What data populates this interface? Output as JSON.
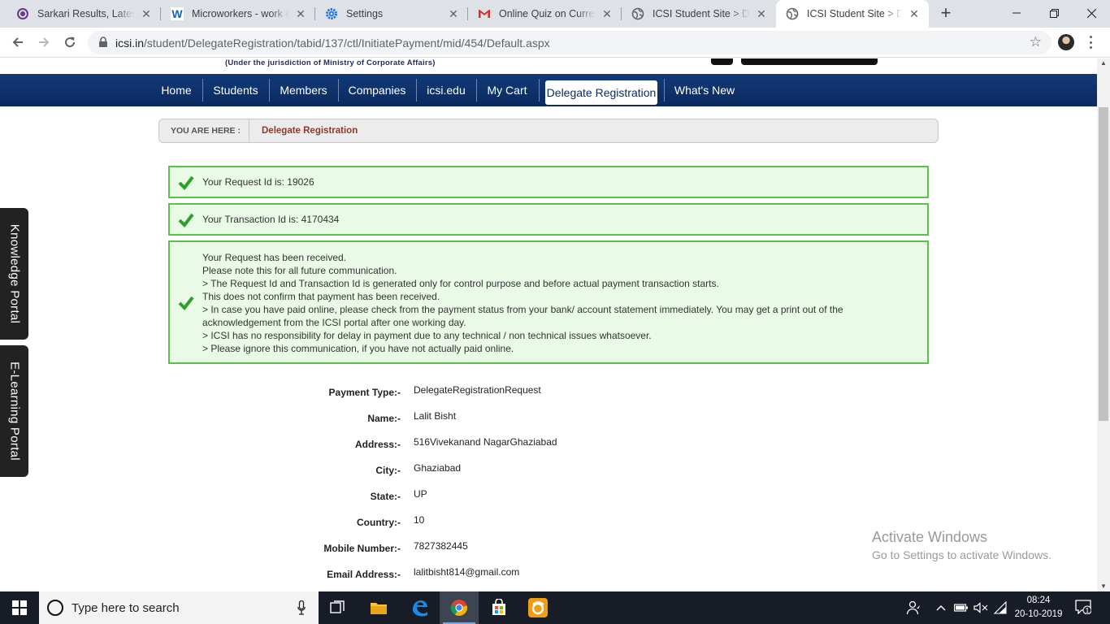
{
  "browser": {
    "tabs": [
      {
        "title": "Sarkari Results, Latest Online",
        "icon": "sarkari-result-icon",
        "active": false
      },
      {
        "title": "Microworkers - work & earn",
        "icon": "microworkers-icon",
        "active": false
      },
      {
        "title": "Settings",
        "icon": "settings-gear-icon",
        "active": false
      },
      {
        "title": "Online Quiz on Current Affairs",
        "icon": "gmail-icon",
        "active": false
      },
      {
        "title": "ICSI Student Site > Delegate Registration",
        "icon": "globe-icon",
        "active": false
      },
      {
        "title": "ICSI Student Site > Delegate Registration",
        "icon": "globe-icon",
        "active": true
      }
    ],
    "new_tab": "+",
    "url_host": "icsi.in",
    "url_path": "/student/DelegateRegistration/tabid/137/ctl/InitiatePayment/mid/454/Default.aspx"
  },
  "header": {
    "jurisdiction": "(Under the jurisdiction of Ministry of Corporate Affairs)"
  },
  "nav": {
    "items": [
      "Home",
      "Students",
      "Members",
      "Companies",
      "icsi.edu",
      "My Cart",
      "Delegate Registration",
      "What's New"
    ],
    "active_index": 6
  },
  "breadcrumb": {
    "label": "YOU ARE HERE :",
    "current": "Delegate Registration"
  },
  "messages": {
    "request_id": "Your Request Id is: 19026",
    "transaction_id": "Your Transaction Id is: 4170434",
    "notice_lines": [
      "Your Request has been received.",
      "Please note this for all future communication.",
      "> The Request Id and Transaction Id is generated only for control purpose and before actual payment transaction starts.",
      "This does not confirm that payment has been received.",
      "> In case you have paid online, please check from the payment status from your bank/ account statement immediately. You may get a print out of the",
      "acknowledgement from the ICSI portal after one working day.",
      "> ICSI has no responsibility for delay in payment due to any technical / non technical issues whatsoever.",
      "> Please ignore this communication, if you have not actually paid online."
    ],
    "success_color": "#58c24a"
  },
  "details": [
    {
      "label": "Payment Type:-",
      "value": "DelegateRegistrationRequest"
    },
    {
      "label": "Name:-",
      "value": "Lalit Bisht"
    },
    {
      "label": "Address:-",
      "value": "516Vivekanand NagarGhaziabad"
    },
    {
      "label": "City:-",
      "value": "Ghaziabad"
    },
    {
      "label": "State:-",
      "value": "UP"
    },
    {
      "label": "Country:-",
      "value": "10"
    },
    {
      "label": "Mobile Number:-",
      "value": "7827382445"
    },
    {
      "label": "Email Address:-",
      "value": "lalitbisht814@gmail.com"
    }
  ],
  "side_tabs": {
    "knowledge": "Knowledge Portal",
    "elearning": "E-Learning Portal"
  },
  "watermark": {
    "line1": "Activate Windows",
    "line2": "Go to Settings to activate Windows."
  },
  "taskbar": {
    "search_placeholder": "Type here to search",
    "time": "08:24",
    "date": "20-10-2019",
    "notification_count": "1"
  },
  "colors": {
    "nav_bg": "#0b2a5e",
    "breadcrumb_current": "#8b3a2b",
    "message_bg": "#e9fbe6"
  }
}
